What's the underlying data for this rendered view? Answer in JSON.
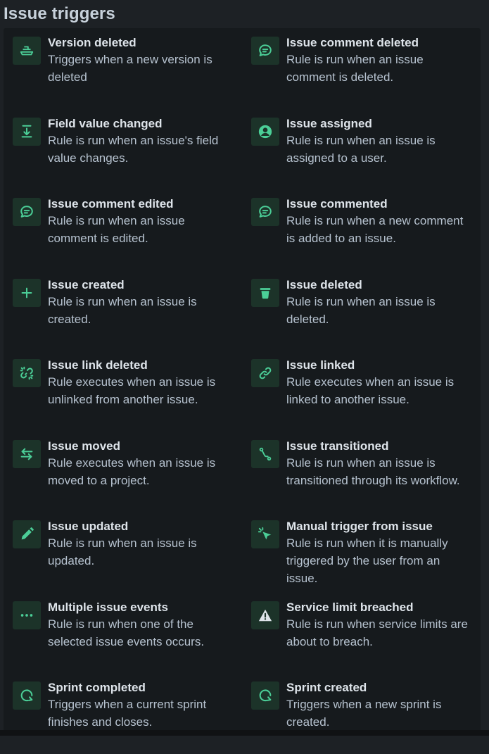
{
  "section": {
    "title": "Issue triggers"
  },
  "colors": {
    "background": "#1d2125",
    "panel": "#161a1d",
    "icon_box": "#1c3329",
    "icon": "#4bce97",
    "title_text": "#dee4ea",
    "desc_text": "#b6c2cf"
  },
  "triggers": [
    {
      "name": "Version deleted",
      "description": "Triggers when a new version is deleted",
      "icon": "ship-icon"
    },
    {
      "name": "Issue comment deleted",
      "description": "Rule is run when an issue comment is deleted.",
      "icon": "comment-icon"
    },
    {
      "name": "Field value changed",
      "description": "Rule is run when an issue's field value changes.",
      "icon": "download-icon"
    },
    {
      "name": "Issue assigned",
      "description": "Rule is run when an issue is assigned to a user.",
      "icon": "user-icon"
    },
    {
      "name": "Issue comment edited",
      "description": "Rule is run when an issue comment is edited.",
      "icon": "comment-icon"
    },
    {
      "name": "Issue commented",
      "description": "Rule is run when a new comment is added to an issue.",
      "icon": "comment-icon"
    },
    {
      "name": "Issue created",
      "description": "Rule is run when an issue is created.",
      "icon": "plus-icon"
    },
    {
      "name": "Issue deleted",
      "description": "Rule is run when an issue is deleted.",
      "icon": "trash-icon"
    },
    {
      "name": "Issue link deleted",
      "description": "Rule executes when an issue is unlinked from another issue.",
      "icon": "unlink-icon"
    },
    {
      "name": "Issue linked",
      "description": "Rule executes when an issue is linked to another issue.",
      "icon": "link-icon"
    },
    {
      "name": "Issue moved",
      "description": "Rule executes when an issue is moved to a project.",
      "icon": "arrows-swap-icon"
    },
    {
      "name": "Issue transitioned",
      "description": "Rule is run when an issue is transitioned through its workflow.",
      "icon": "transition-icon"
    },
    {
      "name": "Issue updated",
      "description": "Rule is run when an issue is updated.",
      "icon": "pencil-icon"
    },
    {
      "name": "Manual trigger from issue",
      "description": "Rule is run when it is manually triggered by the user from an issue.",
      "icon": "cursor-click-icon"
    },
    {
      "name": "Multiple issue events",
      "description": "Rule is run when one of the selected issue events occurs.",
      "icon": "more-icon"
    },
    {
      "name": "Service limit breached",
      "description": "Rule is run when service limits are about to breach.",
      "icon": "warning-icon"
    },
    {
      "name": "Sprint completed",
      "description": "Triggers when a current sprint finishes and closes.",
      "icon": "sprint-icon"
    },
    {
      "name": "Sprint created",
      "description": "Triggers when a new sprint is created.",
      "icon": "sprint-icon"
    }
  ]
}
